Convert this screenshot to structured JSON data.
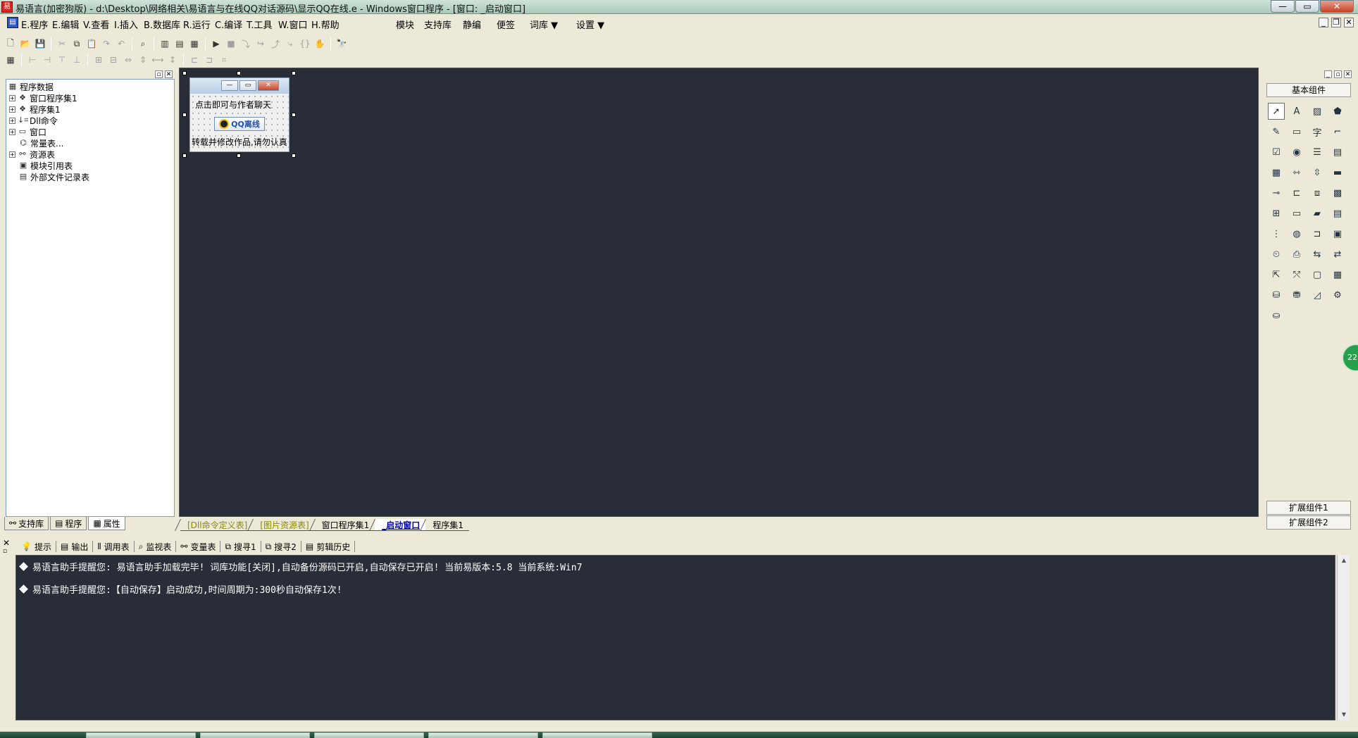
{
  "window": {
    "title": "易语言(加密狗版) - d:\\Desktop\\网络相关\\易语言与在线QQ对话源码\\显示QQ在线.e - Windows窗口程序 - [窗口: _启动窗口]",
    "app_icon": "e-language-icon"
  },
  "menu": {
    "items": [
      {
        "label": "E.程序"
      },
      {
        "label": "E.编辑"
      },
      {
        "label": "V.查看"
      },
      {
        "label": "I.插入"
      },
      {
        "label": "B.数据库"
      },
      {
        "label": "R.运行"
      },
      {
        "label": "C.编译"
      },
      {
        "label": "T.工具"
      },
      {
        "label": "W.窗口"
      },
      {
        "label": "H.帮助"
      }
    ],
    "extras": [
      {
        "label": "模块"
      },
      {
        "label": "支持库"
      },
      {
        "label": "静编"
      },
      {
        "label": "便签"
      },
      {
        "label": "词库 ▼"
      },
      {
        "label": "设置 ▼"
      }
    ]
  },
  "tree": {
    "root": "程序数据",
    "nodes": [
      {
        "label": "窗口程序集1",
        "icon": "assembly-icon"
      },
      {
        "label": "程序集1",
        "icon": "assembly-icon"
      },
      {
        "label": "Dll命令",
        "icon": "dll-icon"
      },
      {
        "label": "窗口",
        "icon": "window-icon"
      },
      {
        "label": "常量表...",
        "icon": "constant-icon"
      },
      {
        "label": "资源表",
        "icon": "resource-icon"
      },
      {
        "label": "模块引用表",
        "icon": "module-icon"
      },
      {
        "label": "外部文件记录表",
        "icon": "file-icon"
      }
    ]
  },
  "left_tabs": [
    {
      "label": "支持库"
    },
    {
      "label": "程序"
    },
    {
      "label": "属性"
    }
  ],
  "form": {
    "label1": "点击即可与作者聊天",
    "qq_button": "QQ离线",
    "label2": "转载并修改作品,请勿认真"
  },
  "design_tabs": [
    {
      "label": "[Dll命令定义表]"
    },
    {
      "label": "[图片资源表]"
    },
    {
      "label": "窗口程序集1"
    },
    {
      "label": "_启动窗口"
    },
    {
      "label": "程序集1"
    }
  ],
  "right_panel": {
    "header": "基本组件",
    "ext1": "扩展组件1",
    "ext2": "扩展组件2",
    "fab": "22"
  },
  "output_tabs": [
    {
      "label": "提示"
    },
    {
      "label": "输出"
    },
    {
      "label": "调用表"
    },
    {
      "label": "监视表"
    },
    {
      "label": "变量表"
    },
    {
      "label": "搜寻1"
    },
    {
      "label": "搜寻2"
    },
    {
      "label": "剪辑历史"
    }
  ],
  "output_lines": [
    "易语言助手提醒您:  易语言助手加载完毕!  词库功能[关闭],自动备份源码已开启,自动保存已开启!  当前易版本:5.8  当前系统:Win7",
    "易语言助手提醒您:【自动保存】启动成功,时间周期为:300秒自动保存1次!"
  ]
}
